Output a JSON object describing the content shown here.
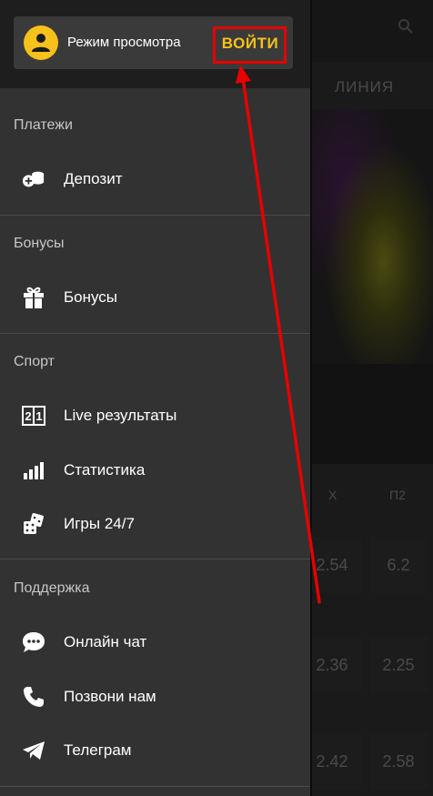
{
  "background_app": {
    "tab_label": "ЛИНИЯ",
    "columns": [
      "X",
      "П2"
    ],
    "odds": [
      [
        "2.54",
        "6.2"
      ],
      [
        "2.36",
        "2.25"
      ],
      [
        "2.42",
        "2.58"
      ]
    ]
  },
  "header": {
    "mode_label": "Режим просмотра",
    "login_label": "ВОЙТИ"
  },
  "sections": [
    {
      "title": "Платежи",
      "items": [
        {
          "label": "Депозит",
          "icon": "coins-icon"
        }
      ]
    },
    {
      "title": "Бонусы",
      "items": [
        {
          "label": "Бонусы",
          "icon": "gift-icon"
        }
      ]
    },
    {
      "title": "Спорт",
      "items": [
        {
          "label": "Live результаты",
          "icon": "scoreboard-icon"
        },
        {
          "label": "Статистика",
          "icon": "bar-chart-icon"
        },
        {
          "label": "Игры 24/7",
          "icon": "dice-icon"
        }
      ]
    },
    {
      "title": "Поддержка",
      "items": [
        {
          "label": "Онлайн чат",
          "icon": "chat-bubble-icon"
        },
        {
          "label": "Позвони нам",
          "icon": "phone-icon"
        },
        {
          "label": "Телеграм",
          "icon": "telegram-icon"
        }
      ]
    }
  ],
  "colors": {
    "accent": "#f7c11b",
    "drawer_bg": "#323232",
    "header_bg": "#1e1e1e",
    "annotation": "#e60000"
  }
}
